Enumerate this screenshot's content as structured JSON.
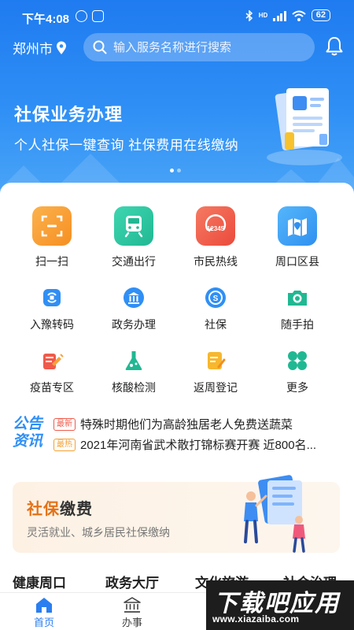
{
  "status_bar": {
    "time": "下午4:08",
    "network_hd": "HD",
    "battery": "62"
  },
  "header": {
    "city": "郑州市",
    "search_placeholder": "输入服务名称进行搜索"
  },
  "banner": {
    "title": "社保业务办理",
    "subtitle": "个人社保一键查询 社保费用在线缴纳",
    "page_count": 2,
    "active_page": 1
  },
  "main_services": [
    {
      "label": "扫一扫",
      "icon": "scan-icon",
      "color": "#f9a23a"
    },
    {
      "label": "交通出行",
      "icon": "train-icon",
      "color": "#2fc6a2"
    },
    {
      "label": "市民热线",
      "icon": "hotline-12345-icon",
      "color": "#f0624e"
    },
    {
      "label": "周口区县",
      "icon": "map-icon",
      "color": "#3ea6f5"
    }
  ],
  "services_row2": [
    {
      "label": "入豫转码",
      "icon": "transfer-code-icon"
    },
    {
      "label": "政务办理",
      "icon": "government-icon"
    },
    {
      "label": "社保",
      "icon": "social-security-icon"
    },
    {
      "label": "随手拍",
      "icon": "camera-icon"
    }
  ],
  "services_row3": [
    {
      "label": "疫苗专区",
      "icon": "vaccine-icon"
    },
    {
      "label": "核酸检测",
      "icon": "flask-icon"
    },
    {
      "label": "返周登记",
      "icon": "register-icon"
    },
    {
      "label": "更多",
      "icon": "more-icon"
    }
  ],
  "notice": {
    "logo_line1": "公告",
    "logo_line2": "资讯",
    "items": [
      {
        "tag": "最新",
        "text": "特殊时期他们为高龄独居老人免费送蔬菜"
      },
      {
        "tag": "最热",
        "text": "2021年河南省武术散打锦标赛开赛 近800名..."
      }
    ]
  },
  "promo": {
    "title_a": "社保",
    "title_b": "缴费",
    "subtitle": "灵活就业、城乡居民社保缴纳"
  },
  "category_tabs": [
    "健康周口",
    "政务大厅",
    "文化旅游",
    "社会治理"
  ],
  "tabbar": [
    {
      "label": "首页",
      "icon": "home-icon",
      "active": true
    },
    {
      "label": "办事",
      "icon": "bank-icon",
      "active": false
    }
  ],
  "watermark": {
    "text": "下载吧应用",
    "url": "www.xiazaiba.com"
  },
  "colors": {
    "primary": "#2f8ff5",
    "active_tab": "#2a7ef0",
    "promo_orange": "#e37218"
  }
}
